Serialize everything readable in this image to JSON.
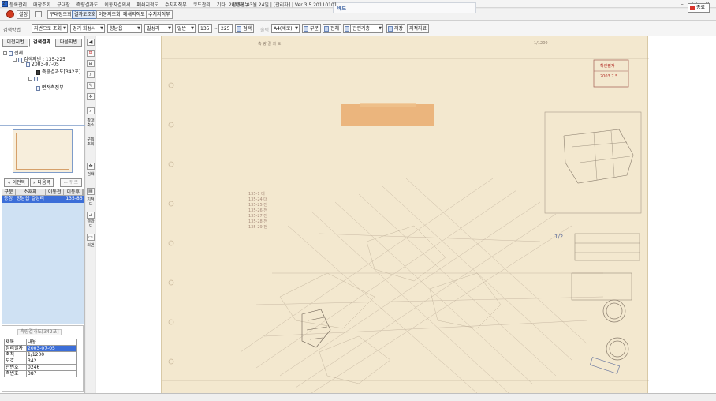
{
  "app": {
    "menu": [
      "등록관리",
      "대장조회",
      "구대장",
      "측량결과도",
      "이동지결의서",
      "폐쇄지적도",
      "수치지적부",
      "코드관리",
      "기타",
      "환경메뉴"
    ]
  },
  "toolbar1": {
    "buttons": [
      "설정",
      "구대장조회",
      "결과도조회",
      "이동지조회",
      "폐쇄지적도",
      "수치지적부"
    ]
  },
  "toolbar2": {
    "search_method_label": "검색방법",
    "search_method": "지번으로 조회",
    "sido": "경기 화성시",
    "eupmyeon": "향남읍",
    "ri": "길성리",
    "land_type": "일반",
    "bunji_from": "135",
    "bunji_sep": "~",
    "bunji_to": "225",
    "search_btn": "검색",
    "print_label": "출력",
    "paper_size": "A4(세로)",
    "part_btn": "부분",
    "all_btn": "전체",
    "shrink_btn": "축소",
    "rotate_btn": "회전",
    "layer_label": "배드",
    "layer_value": "관련계층",
    "save_btn": "저장",
    "cadastral_btn": "지적자료",
    "exit_btn": "종료"
  },
  "left_panel": {
    "tabs": [
      "이전지번",
      "검색결과",
      "다음지번"
    ],
    "tree": {
      "root": "전체",
      "search_range": "검색지번 : 135-225",
      "date": "2003-07-05",
      "result_map": "측량결과도[342포]",
      "area_book": "면적측정부"
    },
    "nav": {
      "prev": "이전목",
      "next": "다음목",
      "back": "뒤로"
    },
    "result_columns": [
      "구분",
      "소재지",
      "이동전",
      "이동후"
    ],
    "result_row": [
      "동정",
      "향남읍 길성리",
      "",
      "135-86"
    ],
    "attr_title": "측량결과도[342포]",
    "attr_header": [
      "제목",
      "내용"
    ],
    "attributes": [
      {
        "key": "정리일자",
        "value": "2003-07-05"
      },
      {
        "key": "축척",
        "value": "1/1200"
      },
      {
        "key": "도호",
        "value": "342"
      },
      {
        "key": "관번호",
        "value": "0246"
      },
      {
        "key": "측번호",
        "value": "387"
      }
    ]
  },
  "tool_strip": {
    "labels": [
      "확대축소",
      "축소",
      "구획조회",
      "검색",
      "전체화면",
      "지적도",
      "면적측정",
      "결과도",
      "지번",
      "외번"
    ]
  },
  "document": {
    "stamp_check": "확인필자",
    "stamp_date": "2003.7.5",
    "handwritten_num": "1/2",
    "legend_text": [
      "135-1 대",
      "135-24 대",
      "135-25 전",
      "135-26 전",
      "135-27 전",
      "135-28 전",
      "135-29 전"
    ]
  },
  "status": {
    "page_num": "2",
    "date": "2015년 03월 24일",
    "user": "[관리자]",
    "version": "Ver 3.5 20110101"
  }
}
